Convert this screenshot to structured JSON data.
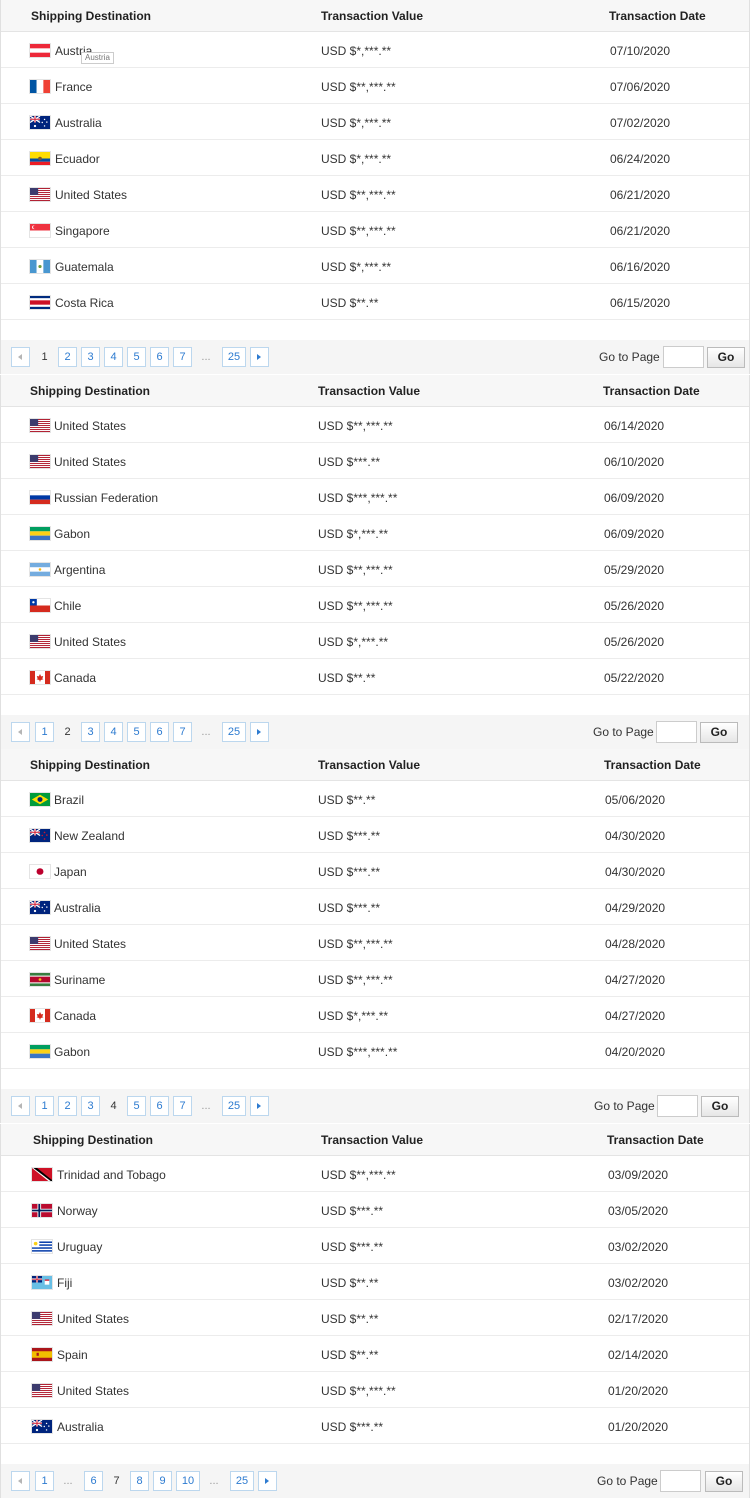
{
  "headers": {
    "destination": "Shipping Destination",
    "value": "Transaction Value",
    "date": "Transaction Date"
  },
  "tooltip": "Austria",
  "pagination": {
    "goto_label": "Go to Page",
    "go_button": "Go",
    "ellipsis": "..."
  },
  "icons": {
    "prev": "chevron-left-icon",
    "next": "chevron-right-icon"
  },
  "blocks": [
    {
      "rows": [
        {
          "flag": "austria",
          "country": "Austria",
          "value": "USD $*,***.**",
          "date": "07/10/2020"
        },
        {
          "flag": "france",
          "country": "France",
          "value": "USD $**,***.**",
          "date": "07/06/2020"
        },
        {
          "flag": "australia",
          "country": "Australia",
          "value": "USD $*,***.**",
          "date": "07/02/2020"
        },
        {
          "flag": "ecuador",
          "country": "Ecuador",
          "value": "USD $*,***.**",
          "date": "06/24/2020"
        },
        {
          "flag": "us",
          "country": "United States",
          "value": "USD $**,***.**",
          "date": "06/21/2020"
        },
        {
          "flag": "singapore",
          "country": "Singapore",
          "value": "USD $**,***.**",
          "date": "06/21/2020"
        },
        {
          "flag": "guatemala",
          "country": "Guatemala",
          "value": "USD $*,***.**",
          "date": "06/16/2020"
        },
        {
          "flag": "costarica",
          "country": "Costa Rica",
          "value": "USD $**.**",
          "date": "06/15/2020"
        }
      ],
      "current_page": "1",
      "pages": [
        "1",
        "2",
        "3",
        "4",
        "5",
        "6",
        "7",
        "...",
        "25"
      ]
    },
    {
      "rows": [
        {
          "flag": "us",
          "country": "United States",
          "value": "USD $**,***.**",
          "date": "06/14/2020"
        },
        {
          "flag": "us",
          "country": "United States",
          "value": "USD $***.**",
          "date": "06/10/2020"
        },
        {
          "flag": "russia",
          "country": "Russian Federation",
          "value": "USD $***,***.**",
          "date": "06/09/2020"
        },
        {
          "flag": "gabon",
          "country": "Gabon",
          "value": "USD $*,***.**",
          "date": "06/09/2020"
        },
        {
          "flag": "argentina",
          "country": "Argentina",
          "value": "USD $**,***.**",
          "date": "05/29/2020"
        },
        {
          "flag": "chile",
          "country": "Chile",
          "value": "USD $**,***.**",
          "date": "05/26/2020"
        },
        {
          "flag": "us",
          "country": "United States",
          "value": "USD $*,***.**",
          "date": "05/26/2020"
        },
        {
          "flag": "canada",
          "country": "Canada",
          "value": "USD $**.**",
          "date": "05/22/2020"
        }
      ],
      "current_page": "2",
      "pages": [
        "1",
        "2",
        "3",
        "4",
        "5",
        "6",
        "7",
        "...",
        "25"
      ]
    },
    {
      "rows": [
        {
          "flag": "brazil",
          "country": "Brazil",
          "value": "USD $**.**",
          "date": "05/06/2020"
        },
        {
          "flag": "newzealand",
          "country": "New Zealand",
          "value": "USD $***.**",
          "date": "04/30/2020"
        },
        {
          "flag": "japan",
          "country": "Japan",
          "value": "USD $***.**",
          "date": "04/30/2020"
        },
        {
          "flag": "australia",
          "country": "Australia",
          "value": "USD $***.**",
          "date": "04/29/2020"
        },
        {
          "flag": "us",
          "country": "United States",
          "value": "USD $**,***.**",
          "date": "04/28/2020"
        },
        {
          "flag": "suriname",
          "country": "Suriname",
          "value": "USD $**,***.**",
          "date": "04/27/2020"
        },
        {
          "flag": "canada",
          "country": "Canada",
          "value": "USD $*,***.**",
          "date": "04/27/2020"
        },
        {
          "flag": "gabon",
          "country": "Gabon",
          "value": "USD $***,***.**",
          "date": "04/20/2020"
        }
      ],
      "current_page": "4",
      "pages": [
        "1",
        "2",
        "3",
        "4",
        "5",
        "6",
        "7",
        "...",
        "25"
      ]
    },
    {
      "rows": [
        {
          "flag": "trinidad",
          "country": "Trinidad and Tobago",
          "value": "USD $**,***.**",
          "date": "03/09/2020"
        },
        {
          "flag": "norway",
          "country": "Norway",
          "value": "USD $***.**",
          "date": "03/05/2020"
        },
        {
          "flag": "uruguay",
          "country": "Uruguay",
          "value": "USD $***.**",
          "date": "03/02/2020"
        },
        {
          "flag": "fiji",
          "country": "Fiji",
          "value": "USD $**.**",
          "date": "03/02/2020"
        },
        {
          "flag": "us",
          "country": "United States",
          "value": "USD $**.**",
          "date": "02/17/2020"
        },
        {
          "flag": "spain",
          "country": "Spain",
          "value": "USD $**.**",
          "date": "02/14/2020"
        },
        {
          "flag": "us",
          "country": "United States",
          "value": "USD $**,***.**",
          "date": "01/20/2020"
        },
        {
          "flag": "australia",
          "country": "Australia",
          "value": "USD $***.**",
          "date": "01/20/2020"
        }
      ],
      "current_page": "7",
      "pages": [
        "1",
        "...",
        "6",
        "7",
        "8",
        "9",
        "10",
        "...",
        "25"
      ]
    }
  ]
}
